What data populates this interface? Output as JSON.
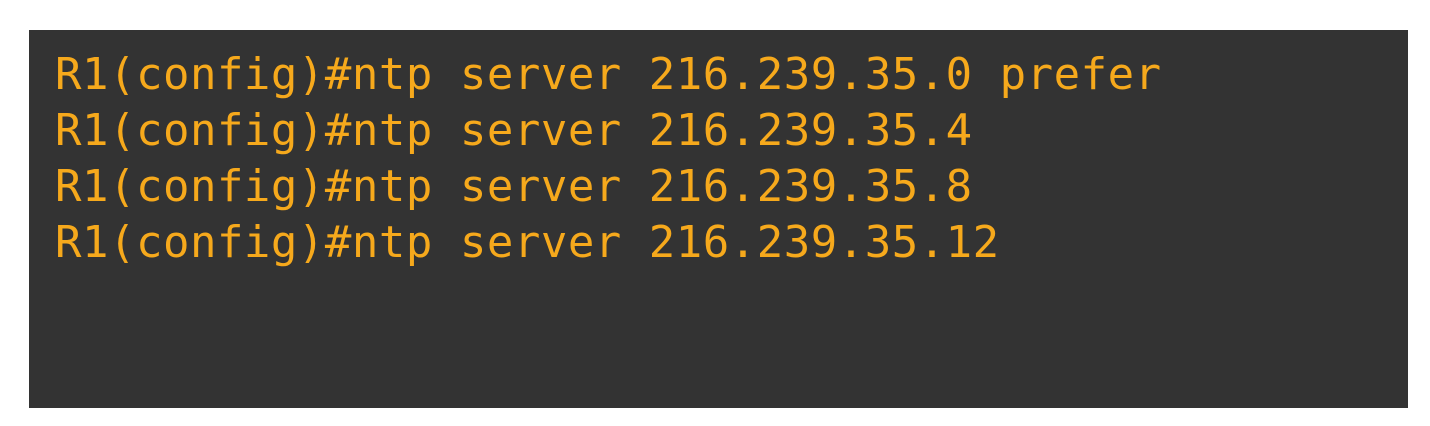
{
  "terminal": {
    "lines": [
      "R1(config)#ntp server 216.239.35.0 prefer",
      "R1(config)#ntp server 216.239.35.4",
      "R1(config)#ntp server 216.239.35.8",
      "R1(config)#ntp server 216.239.35.12"
    ]
  },
  "colors": {
    "background": "#333333",
    "text": "#f6a91c",
    "page": "#ffffff"
  }
}
